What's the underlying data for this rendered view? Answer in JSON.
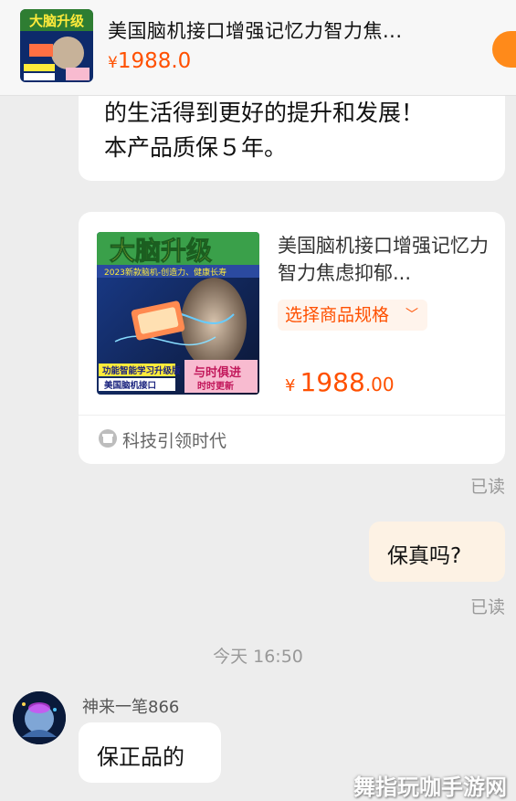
{
  "top_product": {
    "title": "美国脑机接口增强记忆力智力焦...",
    "currency": "¥",
    "price": "1988.0"
  },
  "messages": {
    "first_bubble": {
      "line1": "的生活得到更好的提升和发展！",
      "line2": "本产品质保５年。"
    },
    "product_card": {
      "title": "美国脑机接口增强记忆力智力焦虑抑郁...",
      "spec_button": "选择商品规格",
      "currency": "¥",
      "price_int": "1988",
      "price_dec": ".00",
      "shop_name": "科技引领时代",
      "image_text": {
        "headline": "大脑升级",
        "sub": "2023新款脑机-创造力、健康长寿",
        "badge1": "功能智能学习升级版",
        "badge2": "美国脑机接口",
        "slogan1": "与时俱进",
        "slogan2": "时时更新"
      }
    },
    "read1": "已读",
    "my_message": "保真吗?",
    "read2": "已读",
    "timestamp": "今天 16:50",
    "sender_name": "神来一笔866",
    "reply": "保正品的"
  },
  "watermark": "舞指玩咖手游网",
  "colors": {
    "accent": "#ff5000",
    "my_bubble": "#fdf2e4",
    "background": "#ededed"
  }
}
